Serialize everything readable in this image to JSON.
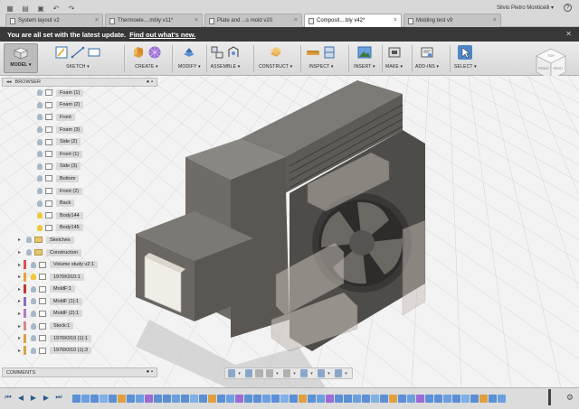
{
  "appbar": {
    "icons": [
      "grid-icon",
      "file-icon",
      "save-icon",
      "undo-icon",
      "redo-icon"
    ],
    "tabs": [
      {
        "label": "System layout v2",
        "active": false
      },
      {
        "label": "Thermoele....mbly v11*",
        "active": false
      },
      {
        "label": "Plate and ...s mold v20",
        "active": false
      },
      {
        "label": "Composit....bly v42*",
        "active": true
      },
      {
        "label": "Molding test v9",
        "active": false
      }
    ],
    "user": "Silvio Pietro Monticelli ▾",
    "help": "?"
  },
  "banner": {
    "text": "You are all set with the latest update.",
    "link": "Find out what's new.",
    "close": "✕"
  },
  "toolbar": {
    "workspace": "MODEL ▾",
    "groups": [
      {
        "label": "SKETCH ▾"
      },
      {
        "label": "CREATE ▾"
      },
      {
        "label": "MODIFY ▾"
      },
      {
        "label": "ASSEMBLE ▾"
      },
      {
        "label": "CONSTRUCT ▾"
      },
      {
        "label": "INSPECT ▾"
      },
      {
        "label": "INSERT ▾"
      },
      {
        "label": "MAKE ▾"
      },
      {
        "label": "ADD-INS ▾"
      },
      {
        "label": "SELECT ▾"
      }
    ]
  },
  "browser": {
    "title": "BROWSER",
    "controls": "● ▪",
    "items": [
      {
        "label": "Foam (1)",
        "kind": "body",
        "light": "off"
      },
      {
        "label": "Foam (2)",
        "kind": "body",
        "light": "off"
      },
      {
        "label": "Front",
        "kind": "body",
        "light": "off"
      },
      {
        "label": "Foam (3)",
        "kind": "body",
        "light": "off"
      },
      {
        "label": "Side (2)",
        "kind": "body",
        "light": "off"
      },
      {
        "label": "Front (1)",
        "kind": "body",
        "light": "off"
      },
      {
        "label": "Side (3)",
        "kind": "body",
        "light": "off"
      },
      {
        "label": "Bottom",
        "kind": "body",
        "light": "off"
      },
      {
        "label": "Front (2)",
        "kind": "body",
        "light": "off"
      },
      {
        "label": "Back",
        "kind": "body",
        "light": "off"
      },
      {
        "label": "Body144",
        "kind": "body",
        "light": "on"
      },
      {
        "label": "Body145",
        "kind": "body",
        "light": "on"
      },
      {
        "label": "Sketches",
        "kind": "folder",
        "light": "off"
      },
      {
        "label": "Construction",
        "kind": "folder",
        "light": "off"
      },
      {
        "label": "Volume study v2:1",
        "kind": "comp",
        "light": "off",
        "color": "#d9534f"
      },
      {
        "label": "1976K910:1",
        "kind": "comp",
        "light": "on",
        "color": "#e8a23a"
      },
      {
        "label": "MoldF:1",
        "kind": "comp",
        "light": "off",
        "color": "#c0392b"
      },
      {
        "label": "MoldF (1):1",
        "kind": "comp",
        "light": "off",
        "color": "#8e6bbf"
      },
      {
        "label": "MoldF (2):1",
        "kind": "comp",
        "light": "off",
        "color": "#b07cc6"
      },
      {
        "label": "Stock:1",
        "kind": "comp",
        "light": "off",
        "color": "#d48a8a"
      },
      {
        "label": "1976K910 (1):1",
        "kind": "comp",
        "light": "off",
        "color": "#d9a441"
      },
      {
        "label": "1976K910 (1):3",
        "kind": "comp",
        "light": "off",
        "color": "#d9a441"
      }
    ]
  },
  "comments": {
    "title": "COMMENTS",
    "controls": "● ▪"
  },
  "navbar": {
    "icons": [
      "orbit-icon",
      "look-at-icon",
      "pan-icon",
      "zoom-icon",
      "fit-icon",
      "display-settings-icon",
      "grid-settings-icon",
      "viewports-icon"
    ]
  },
  "viewcube": {
    "faces": [
      "TOP",
      "FRONT",
      "RIGHT"
    ]
  },
  "timeline": {
    "controls": [
      "first-icon",
      "previous-icon",
      "play-icon",
      "next-icon",
      "last-icon"
    ],
    "feature_colors": [
      "#5b8fd6",
      "#6aa0e0",
      "#5b8fd6",
      "#7fb0e6",
      "#5b8fd6",
      "#e0a040",
      "#5b8fd6",
      "#6aa0e0",
      "#9b6bd6",
      "#5b8fd6"
    ],
    "feature_count": 48
  }
}
